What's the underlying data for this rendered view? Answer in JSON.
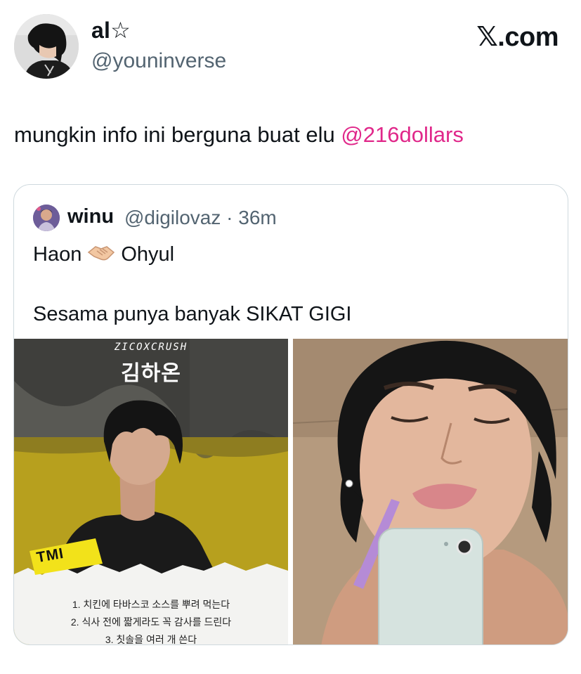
{
  "author": {
    "name": "al☆",
    "handle": "@youninverse"
  },
  "brand": {
    "label": "𝕏.com"
  },
  "tweet": {
    "text": "mungkin info ini berguna buat elu ",
    "mention": "@216dollars"
  },
  "quoted": {
    "name": "winu",
    "meta": "@digilovaz · 36m",
    "line1_a": "Haon",
    "line1_b": "Ohyul",
    "line2": "Sesama punya banyak SIKAT GIGI",
    "poster": {
      "subtitle": "ZICOXCRUSH",
      "title": "김하온",
      "tag": "TMI",
      "lines": [
        "1. 치킨에 타바스코 소스를 뿌려 먹는다",
        "2. 식사 전에 짧게라도 꼭 감사를 드린다",
        "3. 칫솔을 여러 개 쓴다"
      ]
    }
  },
  "colors": {
    "mention": "#e0288a",
    "secondary_text": "#536471",
    "border": "#cfd9de",
    "poster_bg": "#b7a01e"
  }
}
